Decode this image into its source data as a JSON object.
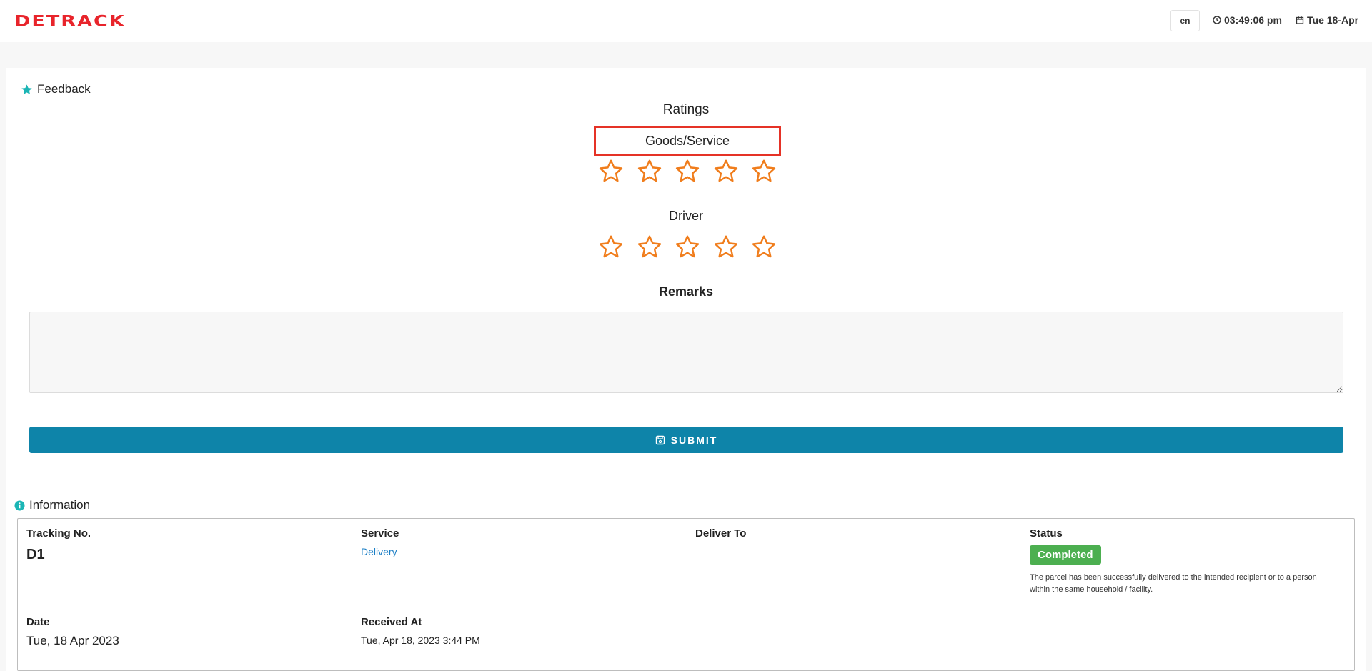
{
  "header": {
    "logo_text": "DETRACK",
    "language": "en",
    "time": "03:49:06 pm",
    "date": "Tue 18-Apr",
    "icons": {
      "time": "clock-icon",
      "date": "calendar-icon"
    }
  },
  "feedback": {
    "section_title": "Feedback",
    "ratings_label": "Ratings",
    "goods_label": "Goods/Service",
    "driver_label": "Driver",
    "remarks_label": "Remarks",
    "remarks_value": "",
    "submit_label": "SUBMIT",
    "goods_rating": 0,
    "driver_rating": 0,
    "max_stars": 5,
    "star_color": "#f07d1c",
    "icon": "star-icon"
  },
  "information": {
    "section_title": "Information",
    "icon": "info-icon",
    "tracking_label": "Tracking No.",
    "tracking_value": "D1",
    "service_label": "Service",
    "service_value": "Delivery",
    "deliver_to_label": "Deliver To",
    "deliver_to_value": "",
    "status_label": "Status",
    "status_value": "Completed",
    "status_description": "The parcel has been successfully delivered to the intended recipient or to a person within the same household / facility.",
    "date_label": "Date",
    "date_value": "Tue, 18 Apr 2023",
    "received_label": "Received At",
    "received_value": "Tue, Apr 18, 2023 3:44 PM"
  },
  "colors": {
    "brand": "#e8242b",
    "accent": "#0e84a9",
    "status_completed": "#4caf50",
    "link": "#1a7ec5",
    "highlight_box": "#e53226",
    "section_icon": "#1bb5b5"
  }
}
